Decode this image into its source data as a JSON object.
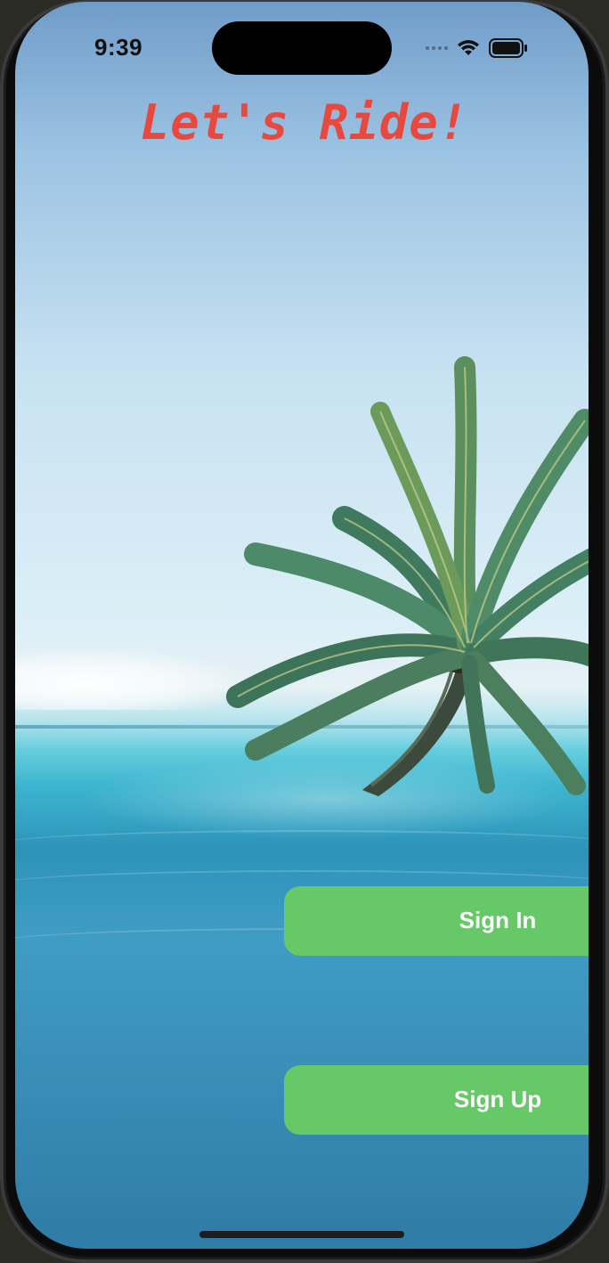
{
  "status_bar": {
    "time": "9:39",
    "icons": [
      "signal-dots-icon",
      "wifi-icon",
      "battery-icon"
    ]
  },
  "main": {
    "title": "Let's Ride!",
    "sign_in_label": "Sign In",
    "sign_up_label": "Sign Up"
  },
  "colors": {
    "title": "#e8493f",
    "button": "#66c866",
    "button_text": "#ffffff"
  }
}
